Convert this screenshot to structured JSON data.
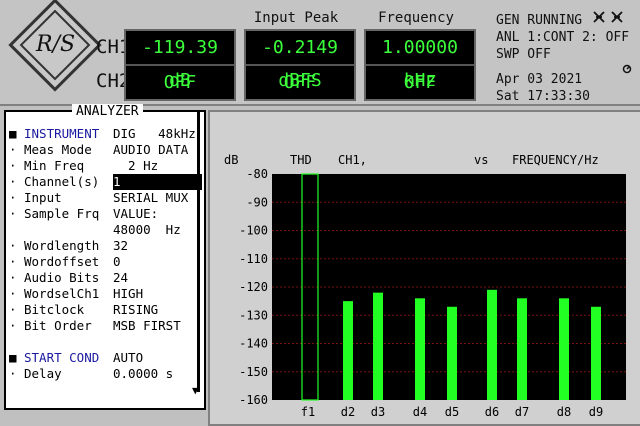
{
  "logo": {
    "text": "R/S"
  },
  "channels": {
    "ch1": "CH1",
    "ch2": "CH2"
  },
  "meters": [
    {
      "header": "",
      "ch1": "-119.39 dB",
      "ch2": "OFF"
    },
    {
      "header": "Input Peak",
      "ch1": "-0.2149 dBFS",
      "ch2": "OFF"
    },
    {
      "header": "Frequency",
      "ch1": "1.00000 kHz",
      "ch2": "OFF"
    }
  ],
  "status": {
    "line1": "GEN RUNNING",
    "line2": "ANL 1:CONT 2: OFF",
    "line3": "SWP OFF",
    "date": "Apr 03 2021",
    "time": "Sat 17:33:30"
  },
  "analyzer": {
    "title": "ANALYZER",
    "rows": [
      {
        "bullet": "■",
        "label": "INSTRUMENT",
        "value": "DIG   48kHz",
        "highlight": true
      },
      {
        "bullet": "·",
        "label": "Meas Mode",
        "value": "AUDIO DATA"
      },
      {
        "bullet": "·",
        "label": "Min Freq",
        "value": "  2 Hz"
      },
      {
        "bullet": "·",
        "label": "Channel(s)",
        "value": "1",
        "selected": true
      },
      {
        "bullet": "·",
        "label": "Input",
        "value": "SERIAL MUX"
      },
      {
        "bullet": "·",
        "label": "Sample Frq",
        "value": "VALUE:"
      },
      {
        "bullet": "",
        "label": "",
        "value": "48000  Hz"
      },
      {
        "bullet": "·",
        "label": "Wordlength",
        "value": "32"
      },
      {
        "bullet": "·",
        "label": "Wordoffset",
        "value": "0"
      },
      {
        "bullet": "·",
        "label": "Audio Bits",
        "value": "24"
      },
      {
        "bullet": "·",
        "label": "WordselCh1",
        "value": "HIGH"
      },
      {
        "bullet": "·",
        "label": "Bitclock",
        "value": "RISING"
      },
      {
        "bullet": "·",
        "label": "Bit Order",
        "value": "MSB FIRST"
      },
      {
        "bullet": "",
        "label": "",
        "value": ""
      },
      {
        "bullet": "■",
        "label": "START COND",
        "value": "AUTO",
        "highlight": true
      },
      {
        "bullet": "·",
        "label": "Delay",
        "value": "0.0000 s"
      }
    ]
  },
  "chart_data": {
    "type": "bar",
    "header": {
      "unit": "dB",
      "measurement": "THD",
      "channel": "CH1,",
      "vs": "vs",
      "xaxis": "FREQUENCY/Hz"
    },
    "categories": [
      "f1",
      "d2",
      "d3",
      "d4",
      "d5",
      "d6",
      "d7",
      "d8",
      "d9"
    ],
    "values": [
      -80,
      -125,
      -122,
      -124,
      -127,
      -121,
      -124,
      -124,
      -127
    ],
    "first_bar_outline": true,
    "ylim": [
      -160,
      -80
    ],
    "yticks": [
      -80,
      -90,
      -100,
      -110,
      -120,
      -130,
      -140,
      -150,
      -160
    ],
    "grid": true,
    "colors": {
      "bar": "#22ff22",
      "background": "#000000",
      "grid": "#7a1010"
    }
  }
}
